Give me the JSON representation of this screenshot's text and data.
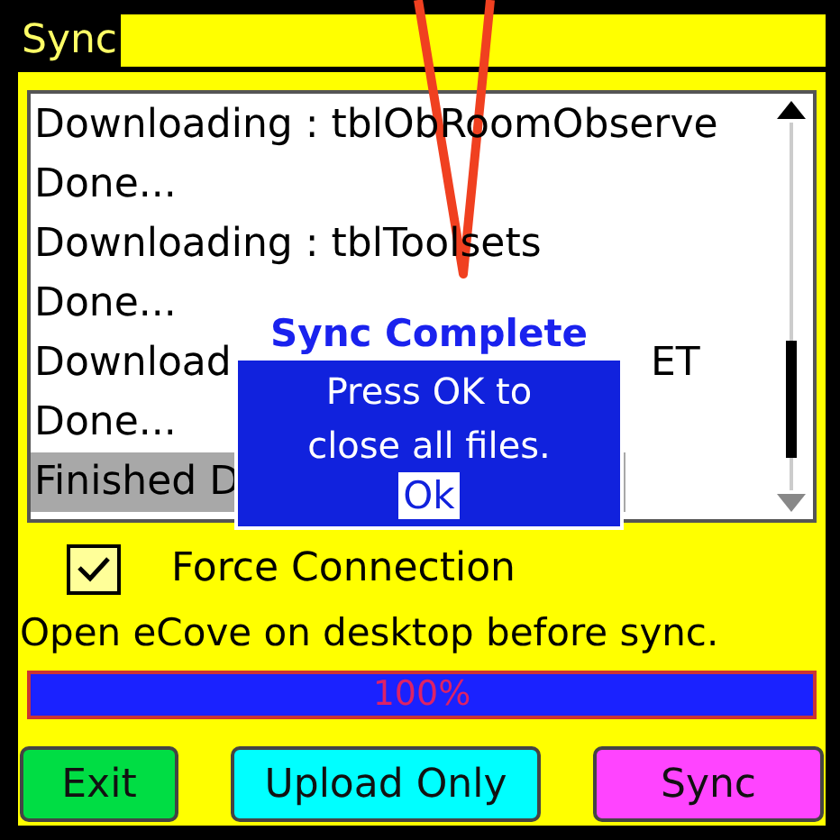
{
  "title_bar": {
    "title": "Sync"
  },
  "log": {
    "lines": [
      {
        "text": "Downloading : tblObRoomObserve",
        "selected": false
      },
      {
        "text": "Done...",
        "selected": false
      },
      {
        "text": "Downloading : tblToolsets",
        "selected": false
      },
      {
        "text": "Done...",
        "selected": false
      },
      {
        "text": "Download",
        "tail": "ET",
        "selected": false
      },
      {
        "text": "Done...",
        "selected": false
      },
      {
        "text": "Finished D",
        "selected": true
      }
    ]
  },
  "dialog": {
    "title": "Sync Complete",
    "message": "Press OK to close all files.",
    "button": "Ok"
  },
  "force_connection": {
    "label": "Force Connection",
    "checked": true
  },
  "hint": "Open eCove on desktop before sync.",
  "progress": {
    "level": 1,
    "reading": "100%"
  },
  "buttons": [
    {
      "label": "Exit",
      "color": "#00dd44"
    },
    {
      "label": "Upload Only",
      "color": "#00ffff"
    },
    {
      "label": "Sync",
      "color": "#ff44ff"
    }
  ]
}
